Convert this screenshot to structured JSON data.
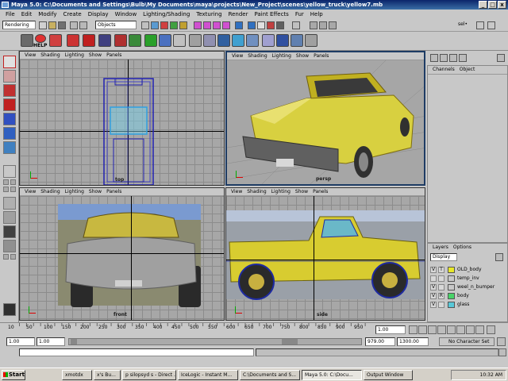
{
  "window": {
    "title": "Maya 5.0: C:\\Documents and Settings\\Bulb\\My Documents\\maya\\projects\\New_Project\\scenes\\yellow_truck\\yellow7.mb",
    "buttons": [
      "_",
      "□",
      "x"
    ]
  },
  "menubar": [
    "File",
    "Edit",
    "Modify",
    "Create",
    "Display",
    "Window",
    "Lighting/Shading",
    "Texturing",
    "Render",
    "Paint Effects",
    "Fur",
    "Help"
  ],
  "statusline": {
    "mode": "Rendering",
    "selection_mask": "Objects",
    "sel_label": "sel•"
  },
  "shelf": {
    "help_label": "HELP"
  },
  "viewports": [
    {
      "id": "top",
      "menu": [
        "View",
        "Shading",
        "Lighting",
        "Show",
        "Panels"
      ],
      "camera": "top"
    },
    {
      "id": "persp",
      "menu": [
        "View",
        "Shading",
        "Lighting",
        "Show",
        "Panels"
      ],
      "camera": "persp"
    },
    {
      "id": "front",
      "menu": [
        "View",
        "Shading",
        "Lighting",
        "Show",
        "Panels"
      ],
      "camera": "front"
    },
    {
      "id": "side",
      "menu": [
        "View",
        "Shading",
        "Lighting",
        "Show",
        "Panels"
      ],
      "camera": "side"
    }
  ],
  "channel_box": {
    "tabs": [
      "Channels",
      "Object"
    ]
  },
  "layers": {
    "tabs": [
      "Layers",
      "Options"
    ],
    "display": "Display",
    "rows": [
      {
        "v": "V",
        "t": "T",
        "color": "#e8e828",
        "name": "OLD_body"
      },
      {
        "v": "",
        "t": "",
        "color": "",
        "name": "temp_inv"
      },
      {
        "v": "V",
        "t": "",
        "color": "",
        "name": "weel_n_bumper"
      },
      {
        "v": "V",
        "t": "R",
        "color": "#48d468",
        "name": "body"
      },
      {
        "v": "V",
        "t": "",
        "color": "#58c8d8",
        "name": "glass"
      }
    ]
  },
  "timeslider": {
    "ticks": [
      "10",
      "50",
      "100",
      "150",
      "200",
      "250",
      "300",
      "350",
      "400",
      "450",
      "500",
      "550",
      "600",
      "650",
      "700",
      "750",
      "800",
      "850",
      "900",
      "950"
    ],
    "current_frame": "1.00"
  },
  "range": {
    "start": "1.00",
    "playback_start": "1.00",
    "playback_end": "979.00",
    "end": "1300.00",
    "character_set": "No Character Set"
  },
  "taskbar": {
    "start": "Start",
    "tasks": [
      "xmotdx",
      "x's Bu...",
      "p silopsyd s - Direct ...",
      "IceLogic - Instant M...",
      "C:\\Documents and S...",
      "Maya 5.0: C:\\Docu...",
      "Output Window"
    ],
    "clock": "10:32 AM"
  }
}
